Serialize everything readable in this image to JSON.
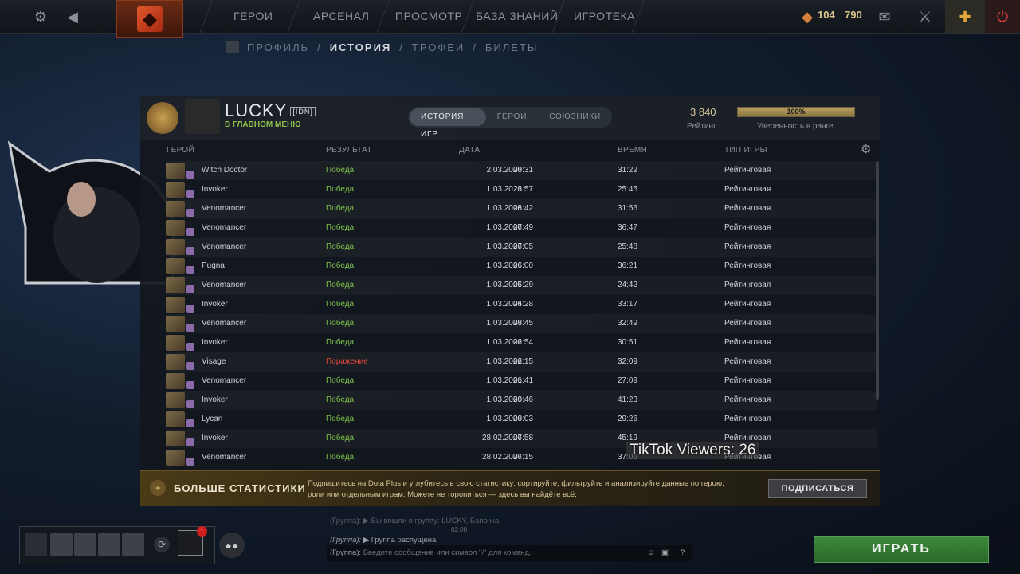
{
  "topbar": {
    "nav": [
      "ГЕРОИ",
      "АРСЕНАЛ",
      "ПРОСМОТР",
      "БАЗА ЗНАНИЙ",
      "ИГРОТЕКА"
    ],
    "shards": "104",
    "coins": "790",
    "icons": [
      "gear-icon",
      "back-arrow-icon",
      "dota-logo",
      "mail-icon",
      "armory-icon",
      "dota-plus-icon",
      "power-icon"
    ]
  },
  "subnav": {
    "items": [
      "ПРОФИЛЬ",
      "ИСТОРИЯ",
      "ТРОФЕИ",
      "БИЛЕТЫ"
    ],
    "active": "ИСТОРИЯ"
  },
  "profile": {
    "name": "LUCKY",
    "tag": "[IDN]",
    "status": "В ГЛАВНОМ МЕНЮ",
    "tabs": [
      "ИСТОРИЯ ИГР",
      "ГЕРОИ",
      "СОЮЗНИКИ"
    ],
    "rating_value": "3 840",
    "rating_label": "Рейтинг",
    "confidence_value": "100%",
    "confidence_fraction": 1.0,
    "confidence_label": "Уверенность в ранге"
  },
  "columns": {
    "hero": "ГЕРОЙ",
    "result": "РЕЗУЛЬТАТ",
    "date": "ДАТА",
    "duration": "ВРЕМЯ",
    "type": "ТИП ИГРЫ"
  },
  "matches": [
    {
      "hero": "Witch Doctor",
      "result": "Победа",
      "date": "2.03.2026",
      "time": "00:31",
      "duration": "31:22",
      "type": "Рейтинговая"
    },
    {
      "hero": "Invoker",
      "result": "Победа",
      "date": "1.03.2026",
      "time": "23:57",
      "duration": "25:45",
      "type": "Рейтинговая"
    },
    {
      "hero": "Venomancer",
      "result": "Победа",
      "date": "1.03.2026",
      "time": "08:42",
      "duration": "31:56",
      "type": "Рейтинговая"
    },
    {
      "hero": "Venomancer",
      "result": "Победа",
      "date": "1.03.2026",
      "time": "07:49",
      "duration": "36:47",
      "type": "Рейтинговая"
    },
    {
      "hero": "Venomancer",
      "result": "Победа",
      "date": "1.03.2026",
      "time": "07:05",
      "duration": "25:48",
      "type": "Рейтинговая"
    },
    {
      "hero": "Pugna",
      "result": "Победа",
      "date": "1.03.2026",
      "time": "06:00",
      "duration": "36:21",
      "type": "Рейтинговая"
    },
    {
      "hero": "Venomancer",
      "result": "Победа",
      "date": "1.03.2026",
      "time": "05:29",
      "duration": "24:42",
      "type": "Рейтинговая"
    },
    {
      "hero": "Invoker",
      "result": "Победа",
      "date": "1.03.2026",
      "time": "04:28",
      "duration": "33:17",
      "type": "Рейтинговая"
    },
    {
      "hero": "Venomancer",
      "result": "Победа",
      "date": "1.03.2026",
      "time": "03:45",
      "duration": "32:49",
      "type": "Рейтинговая"
    },
    {
      "hero": "Invoker",
      "result": "Победа",
      "date": "1.03.2026",
      "time": "02:54",
      "duration": "30:51",
      "type": "Рейтинговая"
    },
    {
      "hero": "Visage",
      "result": "Поражение",
      "date": "1.03.2026",
      "time": "02:15",
      "duration": "32:09",
      "type": "Рейтинговая"
    },
    {
      "hero": "Venomancer",
      "result": "Победа",
      "date": "1.03.2026",
      "time": "01:41",
      "duration": "27:09",
      "type": "Рейтинговая"
    },
    {
      "hero": "Invoker",
      "result": "Победа",
      "date": "1.03.2026",
      "time": "00:46",
      "duration": "41:23",
      "type": "Рейтинговая"
    },
    {
      "hero": "Lycan",
      "result": "Победа",
      "date": "1.03.2026",
      "time": "00:03",
      "duration": "29:26",
      "type": "Рейтинговая"
    },
    {
      "hero": "Invoker",
      "result": "Победа",
      "date": "28.02.2026",
      "time": "07:58",
      "duration": "45:19",
      "type": "Рейтинговая"
    },
    {
      "hero": "Venomancer",
      "result": "Победа",
      "date": "28.02.2026",
      "time": "07:15",
      "duration": "37:06",
      "type": "Рейтинговая"
    }
  ],
  "plus_banner": {
    "title": "БОЛЬШЕ СТАТИСТИКИ",
    "text": "Подпишитесь на Dota Plus и углубитесь в свою статистику: сортируйте, фильтруйте и анализируйте данные по герою, роли или отдельным играм. Можете не торопиться — здесь вы найдёте всё.",
    "button": "ПОДПИСАТЬСЯ"
  },
  "chat": {
    "line1": "(Группа): ▶ Вы вошли в группу: LUCKY, Бапочка",
    "timestamp": "02:00",
    "line2_prefix": "(Группа):",
    "line2": "▶ Группа распущена",
    "input_prefix": "(Группа):",
    "input_placeholder": "Введите сообщение или символ \"/\" для команд."
  },
  "party": {
    "notification_count": "1"
  },
  "play_button": "ИГРАТЬ",
  "overlay": {
    "tiktok": "TikTok Viewers: 26"
  }
}
